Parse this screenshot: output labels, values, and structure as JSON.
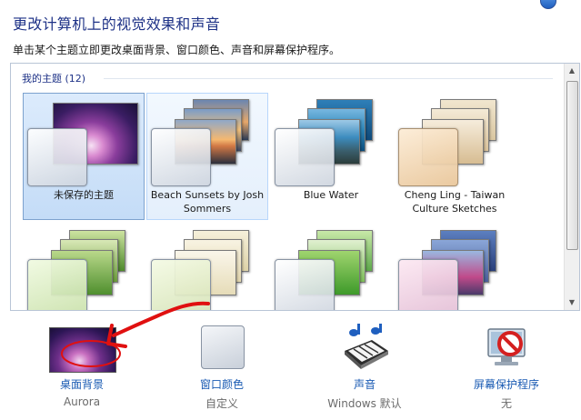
{
  "header": {
    "title": "更改计算机上的视觉效果和声音",
    "description": "单击某个主题立即更改桌面背景、窗口颜色、声音和屏幕保护程序。"
  },
  "themes": {
    "group_label": "我的主题 (12)",
    "items": [
      {
        "name": "未保存的主题",
        "state": "selected"
      },
      {
        "name": "Beach Sunsets by Josh Sommers",
        "state": "hover"
      },
      {
        "name": "Blue Water",
        "state": "normal"
      },
      {
        "name": "Cheng Ling - Taiwan Culture Sketches",
        "state": "normal"
      }
    ]
  },
  "customize": {
    "desktop_background": {
      "label": "桌面背景",
      "value": "Aurora"
    },
    "window_color": {
      "label": "窗口颜色",
      "value": "自定义"
    },
    "sounds": {
      "label": "声音",
      "value": "Windows 默认"
    },
    "screensaver": {
      "label": "屏幕保护程序",
      "value": "无"
    }
  },
  "colors": {
    "title": "#1e3287",
    "link": "#1a5bb3",
    "selected_tile": "#c4dcf7",
    "annotation_red": "#e01010"
  }
}
